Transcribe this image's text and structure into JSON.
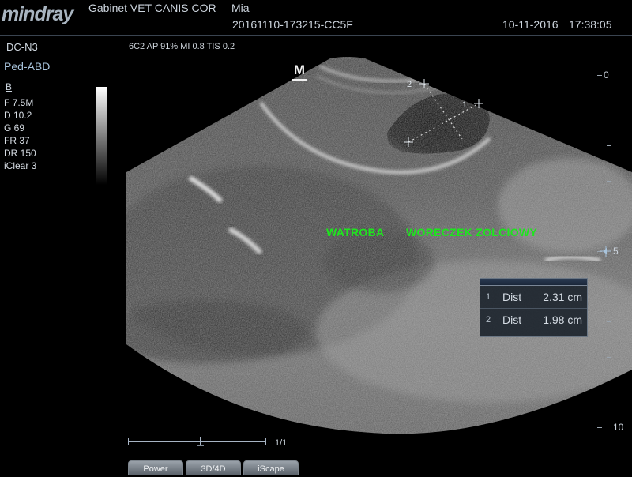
{
  "header": {
    "brand": "mindray",
    "institution": "Gabinet VET CANIS COR",
    "patient": "Mia",
    "study_id": "20161110-173215-CC5F",
    "date": "10-11-2016",
    "time": "17:38:05"
  },
  "left_panel": {
    "probe": "DC-N3",
    "exam": "Ped-ABD",
    "mode": "B",
    "params": [
      "F 7.5M",
      "D 10.2",
      "G 69",
      "FR 37",
      "DR 150",
      "iClear 3"
    ]
  },
  "acoustic": "6C2  AP 91%  MI 0.8  TIS 0.2",
  "orientation_marker": "M",
  "depth_scale": {
    "labels": [
      "0",
      "5",
      "10"
    ],
    "focus_marker_depth_cm": 5
  },
  "annotations": {
    "left_text": "WATROBA",
    "right_text": "WORECZEK ZOLCIOWY"
  },
  "calipers": {
    "label_1": "1",
    "label_2": "2"
  },
  "measurements": [
    {
      "index": "1",
      "name": "Dist",
      "value": "2.31 cm"
    },
    {
      "index": "2",
      "name": "Dist",
      "value": "1.98 cm"
    }
  ],
  "cine": {
    "count": "1/1"
  },
  "softkeys": [
    "Power",
    "3D/4D",
    "iScape"
  ],
  "colors": {
    "annotation_green": "#1de61d",
    "brand_gray": "#a8b4c0",
    "exam_blue": "#a9c4dc"
  }
}
